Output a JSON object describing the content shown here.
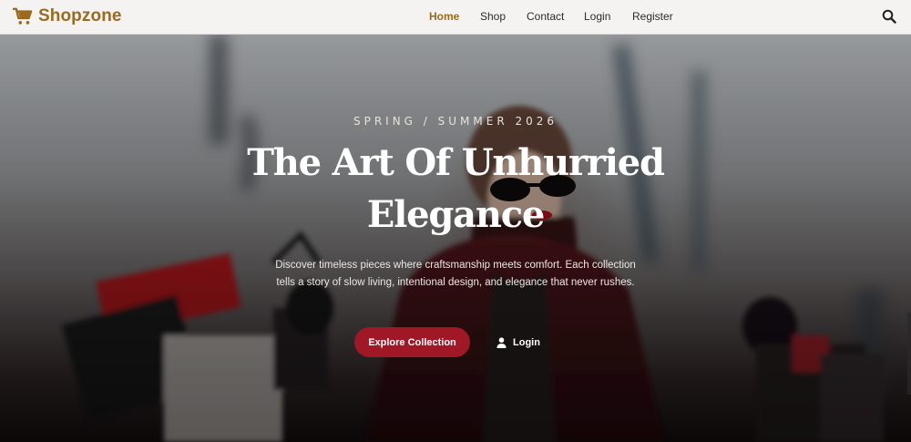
{
  "brand": {
    "name": "Shopzone",
    "icon": "shopping-cart-icon",
    "color": "#9a6a1e"
  },
  "nav": {
    "items": [
      {
        "label": "Home",
        "active": true
      },
      {
        "label": "Shop",
        "active": false
      },
      {
        "label": "Contact",
        "active": false
      },
      {
        "label": "Login",
        "active": false
      },
      {
        "label": "Register",
        "active": false
      }
    ],
    "search_icon": "search-icon"
  },
  "hero": {
    "eyebrow": "SPRING / SUMMER 2026",
    "headline_line1": "The Art Of Unhurried",
    "headline_line2": "Elegance",
    "description": "Discover timeless pieces where craftsmanship meets comfort. Each collection tells a story of slow living, intentional design, and elegance that never rushes.",
    "primary_button": "Explore Collection",
    "secondary_button": "Login",
    "secondary_icon": "user-icon",
    "accent_color": "#a01826"
  }
}
